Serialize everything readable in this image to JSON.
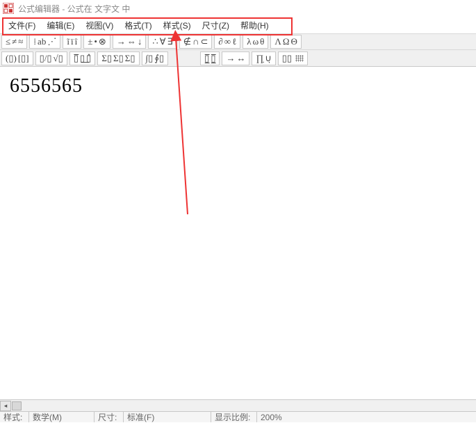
{
  "title": "公式编辑器 - 公式在 文字文 中",
  "menu": {
    "items": [
      {
        "label": "文件(F)"
      },
      {
        "label": "编辑(E)"
      },
      {
        "label": "视图(V)"
      },
      {
        "label": "格式(T)"
      },
      {
        "label": "样式(S)"
      },
      {
        "label": "尺寸(Z)"
      },
      {
        "label": "帮助(H)"
      }
    ]
  },
  "toolbar1": {
    "groups": [
      {
        "name": "relational",
        "glyphs": [
          "≤",
          "≠",
          "≈"
        ]
      },
      {
        "name": "spacing",
        "glyphs": [
          "⁞",
          "a͏b",
          "⋰"
        ]
      },
      {
        "name": "embellish",
        "glyphs": [
          "ĩ",
          "ï",
          "î"
        ]
      },
      {
        "name": "operators",
        "glyphs": [
          "±",
          "•",
          "⊗"
        ]
      },
      {
        "name": "arrows",
        "glyphs": [
          "→",
          "⇔",
          "↓"
        ]
      },
      {
        "name": "logic",
        "glyphs": [
          "∴",
          "∀",
          "∃"
        ]
      },
      {
        "name": "set",
        "glyphs": [
          "∉",
          "∩",
          "⊂"
        ]
      },
      {
        "name": "misc",
        "glyphs": [
          "∂",
          "∞",
          "ℓ"
        ]
      },
      {
        "name": "greek-lower",
        "glyphs": [
          "λ",
          "ω",
          "θ"
        ]
      },
      {
        "name": "greek-upper",
        "glyphs": [
          "Λ",
          "Ω",
          "Θ"
        ]
      }
    ]
  },
  "toolbar2": {
    "groups": [
      {
        "name": "fences",
        "glyphs": [
          "(▯)",
          "[▯]"
        ]
      },
      {
        "name": "fractions",
        "glyphs": [
          "▯/▯",
          "√▯"
        ]
      },
      {
        "name": "scripts",
        "glyphs": [
          "▯̅",
          "▯͟",
          "▯̂"
        ]
      },
      {
        "name": "sums",
        "glyphs": [
          "Σ▯",
          "Σ▯",
          "Σ▯"
        ]
      },
      {
        "name": "integrals",
        "glyphs": [
          "∫▯",
          "∮▯"
        ]
      },
      {
        "name": "spacer",
        "glyphs": []
      },
      {
        "name": "overunder",
        "glyphs": [
          "▯̲̅",
          "▯̲̅"
        ]
      },
      {
        "name": "arrows-long",
        "glyphs": [
          "→",
          "↔"
        ]
      },
      {
        "name": "products",
        "glyphs": [
          "∏̣",
          "∪̣"
        ]
      },
      {
        "name": "matrix",
        "glyphs": [
          "▯▯",
          "grid"
        ]
      }
    ]
  },
  "editor": {
    "content": "6556565"
  },
  "statusbar": {
    "style_label": "样式:",
    "style_value": "数学(M)",
    "size_label": "尺寸:",
    "size_value": "标准(F)",
    "zoom_label": "显示比例:",
    "zoom_value": "200%"
  }
}
